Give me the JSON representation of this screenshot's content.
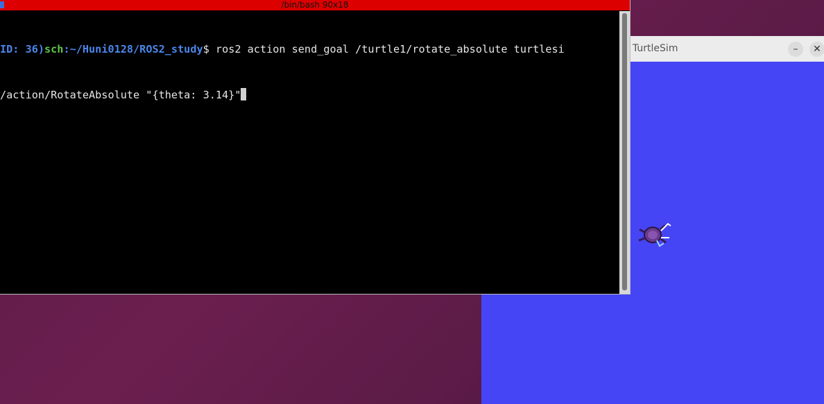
{
  "terminal": {
    "title": "/bin/bash 90x18",
    "prompt_id": "ID: 36)",
    "prompt_user": "sch",
    "prompt_path": ":~/Huni0128/ROS2_study",
    "prompt_symbol": "$",
    "command_line1": " ros2 action send_goal /turtle1/rotate_absolute turtlesi",
    "command_line2": "/action/RotateAbsolute \"{theta: 3.14}\"",
    "colors": {
      "titlebar": "#dd0000",
      "background": "#000000",
      "prompt_blue": "#4b86ea",
      "prompt_green": "#5fc34a"
    }
  },
  "turtlesim": {
    "title": "TurtleSim",
    "minimize_icon": "minimize-icon",
    "close_icon": "close-icon",
    "background_color": "#4545f5",
    "turtle_icon": "turtle-icon"
  },
  "desktop": {
    "background_color": "#5a1b48"
  }
}
